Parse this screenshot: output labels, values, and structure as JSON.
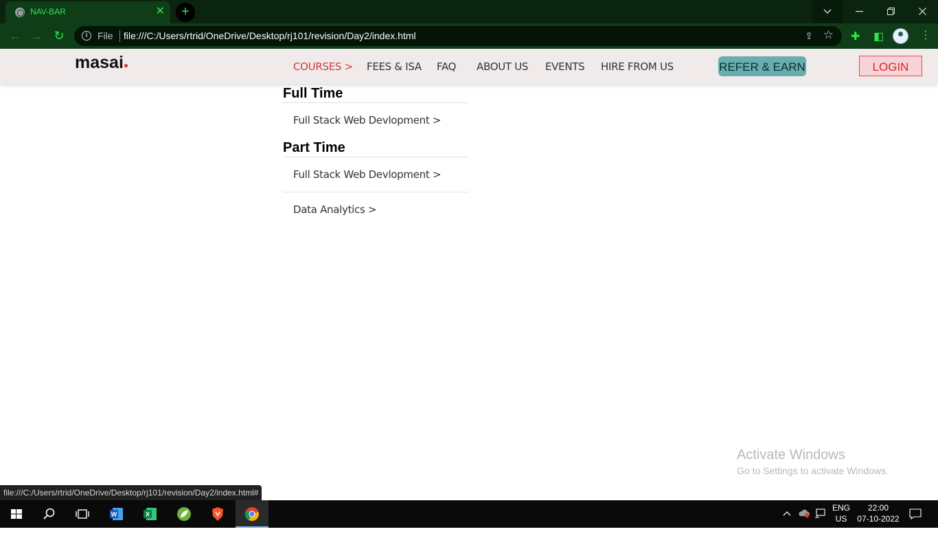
{
  "browser": {
    "tab_title": "NAV-BAR",
    "tab_close": "✕",
    "new_tab": "+",
    "omnibox": {
      "scheme": "File",
      "url": "file:///C:/Users/rtrid/OneDrive/Desktop/rj101/revision/Day2/index.html"
    },
    "status_url": "file:///C:/Users/rtrid/OneDrive/Desktop/rj101/revision/Day2/index.html#"
  },
  "site": {
    "logo": "masai",
    "nav": [
      {
        "label": "COURSES >",
        "active": true
      },
      {
        "label": "FEES & ISA"
      },
      {
        "label": "FAQ"
      },
      {
        "label": "ABOUT US"
      },
      {
        "label": "EVENTS"
      },
      {
        "label": "HIRE FROM US"
      }
    ],
    "refer_label": "REFER & EARN",
    "login_label": "LOGIN",
    "colors": {
      "nav_bg": "#f1eaea",
      "active": "#d33a3a",
      "refer_bg": "#66aeb0",
      "login_bg": "#f7d3d8"
    }
  },
  "dropdown": {
    "full_time_heading": "Full Time",
    "full_time_items": [
      "Full Stack Web Devlopment >"
    ],
    "part_time_heading": "Part Time",
    "part_time_items": [
      "Full Stack Web Devlopment >",
      "Data Analytics >"
    ]
  },
  "watermark": {
    "line1": "Activate Windows",
    "line2": "Go to Settings to activate Windows."
  },
  "taskbar": {
    "apps": [
      "windows-start-icon",
      "search-icon",
      "task-view-icon",
      "word-icon",
      "excel-icon",
      "spring-icon",
      "brave-icon",
      "chrome-icon"
    ],
    "lang_line1": "ENG",
    "lang_line2": "US",
    "time": "22:00",
    "date": "07-10-2022"
  }
}
